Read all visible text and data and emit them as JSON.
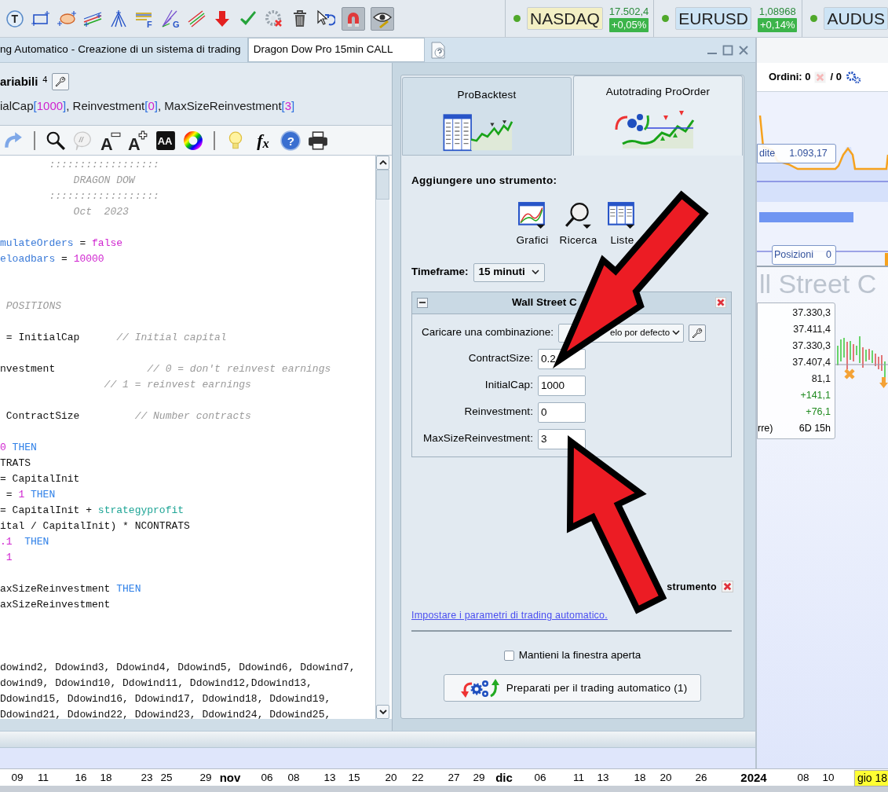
{
  "toolbar": {
    "tools": [
      {
        "kind": "text",
        "glyph": "T",
        "pressed": false
      },
      {
        "kind": "rectangle",
        "pressed": false
      },
      {
        "kind": "ellipse",
        "pressed": false
      },
      {
        "kind": "lines",
        "pressed": false
      },
      {
        "kind": "pitchfork",
        "pressed": false
      },
      {
        "kind": "fibonacci",
        "glyph": "F",
        "pressed": false
      },
      {
        "kind": "fan",
        "glyph": "G",
        "pressed": false
      },
      {
        "kind": "channel",
        "pressed": false
      },
      {
        "kind": "down-arrow",
        "pressed": false
      },
      {
        "kind": "check",
        "pressed": false
      },
      {
        "kind": "gear-remove",
        "pressed": false
      },
      {
        "kind": "trash",
        "pressed": false
      },
      {
        "kind": "cursor-undo",
        "pressed": false
      },
      {
        "kind": "magnet",
        "pressed": true
      },
      {
        "kind": "eye-pencil",
        "pressed": true
      }
    ],
    "tickers": [
      {
        "symbol": "NASDAQ",
        "color": "#f3efc4",
        "price": "17.502,4",
        "change": "+0,05%"
      },
      {
        "symbol": "EURUSD",
        "color": "#cde4f5",
        "price": "1,08968",
        "change": "+0,14%"
      },
      {
        "symbol": "AUDUS",
        "color": "#cde4f5"
      }
    ]
  },
  "window_tabs": [
    {
      "label": "ng Automatico - Creazione di un sistema di trading",
      "selected": true
    },
    {
      "label": "Dragon Dow Pro 15min CALL",
      "selected": false
    }
  ],
  "editor": {
    "title": "ariabili",
    "badge": "4",
    "variables": [
      {
        "text": "ialCap",
        "kind": "name"
      },
      {
        "text": "[",
        "kind": "bracket"
      },
      {
        "text": "1000",
        "kind": "value"
      },
      {
        "text": "]",
        "kind": "bracket"
      },
      {
        "text": ", Reinvestment",
        "kind": "name"
      },
      {
        "text": "[",
        "kind": "bracket"
      },
      {
        "text": "0",
        "kind": "value"
      },
      {
        "text": "]",
        "kind": "bracket"
      },
      {
        "text": ", MaxSizeReinvestment",
        "kind": "name"
      },
      {
        "text": "[",
        "kind": "bracket"
      },
      {
        "text": "3",
        "kind": "value"
      },
      {
        "text": "]",
        "kind": "bracket"
      }
    ],
    "tools": [
      {
        "kind": "redo"
      },
      {
        "kind": "separator"
      },
      {
        "kind": "search"
      },
      {
        "kind": "comment",
        "glyph": "//"
      },
      {
        "kind": "font-smaller",
        "glyph": "A"
      },
      {
        "kind": "font-larger",
        "glyph": "A"
      },
      {
        "kind": "font-style",
        "glyph": "AA"
      },
      {
        "kind": "color"
      },
      {
        "kind": "separator"
      },
      {
        "kind": "tip"
      },
      {
        "kind": "formula",
        "glyph": "f$_{x}$"
      },
      {
        "kind": "help",
        "glyph": "?"
      },
      {
        "kind": "print"
      }
    ],
    "lines": [
      {
        "kind": "code",
        "segments": [
          {
            "text": "        ::::::::::::::::::",
            "kind": "comment"
          }
        ]
      },
      {
        "kind": "code",
        "segments": [
          {
            "text": "            DRAGON DOW",
            "kind": "comment"
          }
        ]
      },
      {
        "kind": "code",
        "segments": [
          {
            "text": "        ::::::::::::::::::",
            "kind": "comment"
          }
        ]
      },
      {
        "kind": "code",
        "segments": [
          {
            "text": "            Oct  2023",
            "kind": "comment"
          }
        ]
      },
      {
        "kind": "blank"
      },
      {
        "kind": "code",
        "segments": [
          {
            "text": "mulateOrders",
            "kind": "variable"
          },
          {
            "text": " = ",
            "kind": "plain"
          },
          {
            "text": "false",
            "kind": "number"
          }
        ]
      },
      {
        "kind": "code",
        "segments": [
          {
            "text": "eloadbars",
            "kind": "variable"
          },
          {
            "text": " = ",
            "kind": "plain"
          },
          {
            "text": "10000",
            "kind": "number"
          }
        ]
      },
      {
        "kind": "blank"
      },
      {
        "kind": "blank"
      },
      {
        "kind": "code",
        "segments": [
          {
            "text": " POSITIONS",
            "kind": "comment"
          }
        ]
      },
      {
        "kind": "blank"
      },
      {
        "kind": "code",
        "segments": [
          {
            "text": " = InitialCap      ",
            "kind": "plain"
          },
          {
            "text": "// Initial capital",
            "kind": "comment"
          }
        ]
      },
      {
        "kind": "blank"
      },
      {
        "kind": "code",
        "segments": [
          {
            "text": "nvestment               ",
            "kind": "plain"
          },
          {
            "text": "// 0 = don't reinvest earnings",
            "kind": "comment"
          }
        ]
      },
      {
        "kind": "code",
        "segments": [
          {
            "text": "                 // 1 = reinvest earnings",
            "kind": "comment"
          }
        ]
      },
      {
        "kind": "blank"
      },
      {
        "kind": "code",
        "segments": [
          {
            "text": " ContractSize         ",
            "kind": "plain"
          },
          {
            "text": "// Number contracts",
            "kind": "comment"
          }
        ]
      },
      {
        "kind": "blank"
      },
      {
        "kind": "code",
        "segments": [
          {
            "text": "0",
            "kind": "number"
          },
          {
            "text": " THEN",
            "kind": "keyword"
          }
        ]
      },
      {
        "kind": "code",
        "segments": [
          {
            "text": "TRATS",
            "kind": "plain"
          }
        ]
      },
      {
        "kind": "code",
        "segments": [
          {
            "text": "= CapitalInit",
            "kind": "plain"
          }
        ]
      },
      {
        "kind": "code",
        "segments": [
          {
            "text": " = ",
            "kind": "plain"
          },
          {
            "text": "1",
            "kind": "number"
          },
          {
            "text": " THEN",
            "kind": "keyword"
          }
        ]
      },
      {
        "kind": "code",
        "segments": [
          {
            "text": "= CapitalInit + ",
            "kind": "plain"
          },
          {
            "text": "strategyprofit",
            "kind": "builtin"
          }
        ]
      },
      {
        "kind": "code",
        "segments": [
          {
            "text": "ital / CapitalInit) * NCONTRATS",
            "kind": "plain"
          }
        ]
      },
      {
        "kind": "code",
        "segments": [
          {
            "text": ".1",
            "kind": "number"
          },
          {
            "text": "  THEN",
            "kind": "keyword"
          }
        ]
      },
      {
        "kind": "code",
        "segments": [
          {
            "text": " 1",
            "kind": "number"
          }
        ]
      },
      {
        "kind": "blank"
      },
      {
        "kind": "code",
        "segments": [
          {
            "text": "axSizeReinvestment ",
            "kind": "plain"
          },
          {
            "text": "THEN",
            "kind": "keyword"
          }
        ]
      },
      {
        "kind": "code",
        "segments": [
          {
            "text": "axSizeReinvestment",
            "kind": "plain"
          }
        ]
      },
      {
        "kind": "blank"
      },
      {
        "kind": "blank"
      },
      {
        "kind": "blank"
      },
      {
        "kind": "code",
        "segments": [
          {
            "text": "dowind2, Ddowind3, Ddowind4, Ddowind5, Ddowind6, Ddowind7,",
            "kind": "plain"
          }
        ]
      },
      {
        "kind": "code",
        "segments": [
          {
            "text": "dowind9, Ddowind10, Ddowind11, Ddowind12,Ddowind13,",
            "kind": "plain"
          }
        ]
      },
      {
        "kind": "code",
        "segments": [
          {
            "text": "Ddowind15, Ddowind16, Ddowind17, Ddowind18, Ddowind19,",
            "kind": "plain"
          }
        ]
      },
      {
        "kind": "code",
        "segments": [
          {
            "text": "Ddowind21, Ddowind22, Ddowind23, Ddowind24, Ddowind25,",
            "kind": "plain"
          }
        ]
      }
    ]
  },
  "proorder": {
    "tabs": [
      {
        "label": "ProBacktest",
        "kind": "backtest",
        "selected": false
      },
      {
        "label": "Autotrading ProOrder",
        "kind": "autotrading",
        "selected": true
      }
    ],
    "add_instrument_label": "Aggiungere uno strumento:",
    "sources": [
      {
        "kind": "charts",
        "label": "Grafici"
      },
      {
        "kind": "search",
        "label": "Ricerca"
      },
      {
        "kind": "lists",
        "label": "Liste"
      }
    ],
    "timeframe": {
      "label": "Timeframe:",
      "value": "15 minuti"
    },
    "instrument": {
      "title": "Wall Street C",
      "combination_label": "Caricare una combinazione:",
      "combination_value": "elo por defecto",
      "params": [
        {
          "label": "ContractSize:",
          "value": "0.2"
        },
        {
          "label": "InitialCap:",
          "value": "1000"
        },
        {
          "label": "Reinvestment:",
          "value": "0"
        },
        {
          "label": "MaxSizeReinvestment:",
          "value": "3"
        }
      ]
    },
    "remove_label": "strumento",
    "settings_link": "Impostare i parametri di trading automatico.",
    "keep_open": {
      "label": "Mantieni la finestra aperta",
      "checked": false
    },
    "submit_button": "Preparati per il trading automatico (1)"
  },
  "chart": {
    "orders_label": "Ordini: 0",
    "orders_total": "/ 0",
    "equity_label": "dite",
    "equity_value": "1.093,17",
    "positions_label": "Posizioni",
    "positions_value": "0",
    "title": "ll Street C",
    "info_values": [
      {
        "text": "37.330,3",
        "kind": "neutral"
      },
      {
        "text": "37.411,4",
        "kind": "neutral"
      },
      {
        "text": "37.330,3",
        "kind": "neutral"
      },
      {
        "text": "37.407,4",
        "kind": "neutral"
      },
      {
        "text": "81,1",
        "kind": "neutral"
      },
      {
        "text": "+141,1",
        "kind": "gain"
      },
      {
        "text": "+76,1",
        "kind": "gain"
      }
    ],
    "info_last_label": "rre)",
    "info_last_value": "6D 15h",
    "axis_labels": [
      {
        "text": "09",
        "kind": "day"
      },
      {
        "text": "11",
        "kind": "day"
      },
      {
        "text": "16",
        "kind": "day"
      },
      {
        "text": "18",
        "kind": "day"
      },
      {
        "text": "23",
        "kind": "day"
      },
      {
        "text": "25",
        "kind": "day"
      },
      {
        "text": "29",
        "kind": "day"
      },
      {
        "text": "nov",
        "kind": "month"
      },
      {
        "text": "06",
        "kind": "day"
      },
      {
        "text": "08",
        "kind": "day"
      },
      {
        "text": "13",
        "kind": "day"
      },
      {
        "text": "15",
        "kind": "day"
      },
      {
        "text": "20",
        "kind": "day"
      },
      {
        "text": "22",
        "kind": "day"
      },
      {
        "text": "27",
        "kind": "day"
      },
      {
        "text": "29",
        "kind": "day"
      },
      {
        "text": "dic",
        "kind": "month"
      },
      {
        "text": "06",
        "kind": "day"
      },
      {
        "text": "11",
        "kind": "day"
      },
      {
        "text": "13",
        "kind": "day"
      },
      {
        "text": "18",
        "kind": "day"
      },
      {
        "text": "20",
        "kind": "day"
      },
      {
        "text": "26",
        "kind": "day"
      },
      {
        "text": "2024",
        "kind": "month"
      },
      {
        "text": "08",
        "kind": "day"
      },
      {
        "text": "10",
        "kind": "day"
      },
      {
        "text": "gio 18",
        "kind": "cursor"
      }
    ]
  }
}
